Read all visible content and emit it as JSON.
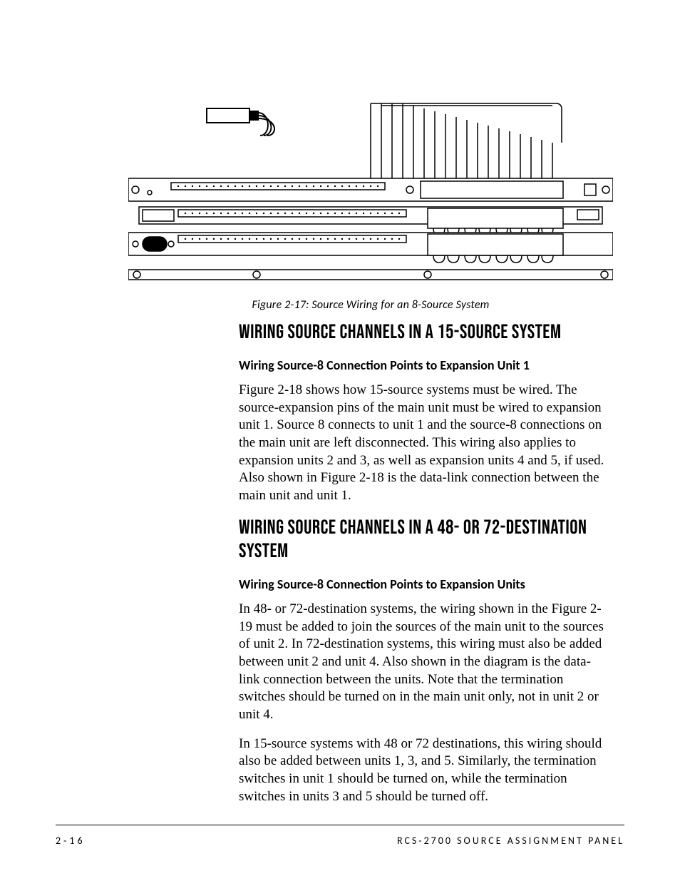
{
  "figure": {
    "caption": "Figure 2-17: Source Wiring for an 8-Source System"
  },
  "section1": {
    "heading": "WIRING SOURCE CHANNELS IN A 15-SOURCE SYSTEM",
    "sub1": {
      "heading": "Wiring Source-8 Connection Points to Expansion Unit 1",
      "para1": "Figure 2-18 shows how 15-source systems must be wired. The source-expansion pins of the main unit must be wired to expansion unit 1. Source 8 connects to unit 1 and the source-8 connections on the main unit are left disconnected. This wiring also applies to expansion units 2 and 3, as well as expansion units 4 and 5, if used. Also shown in Figure 2-18 is the data-link connection between the main unit and unit 1."
    }
  },
  "section2": {
    "heading": "WIRING SOURCE CHANNELS IN A 48- OR 72-DESTINATION SYSTEM",
    "sub1": {
      "heading": "Wiring Source-8 Connection Points to Expansion Units",
      "para1": "In 48- or 72-destination systems, the wiring shown in the Figure 2-19 must be added to join the sources of the main unit to the sources of unit 2. In 72-destination systems, this wiring must also be added between unit 2 and unit 4. Also shown in the diagram is the data-link connection between the units. Note that the termination switches should be turned on in the main unit only, not in unit 2 or unit 4.",
      "para2": "In 15-source systems with 48 or 72 destinations, this wiring should also be added between units 1, 3, and 5. Similarly, the termination switches in unit 1 should be turned on, while the termination switches in units 3 and 5 should be turned off."
    }
  },
  "footer": {
    "pageNumber": "2-16",
    "docTitle": "RCS-2700 SOURCE ASSIGNMENT PANEL"
  }
}
